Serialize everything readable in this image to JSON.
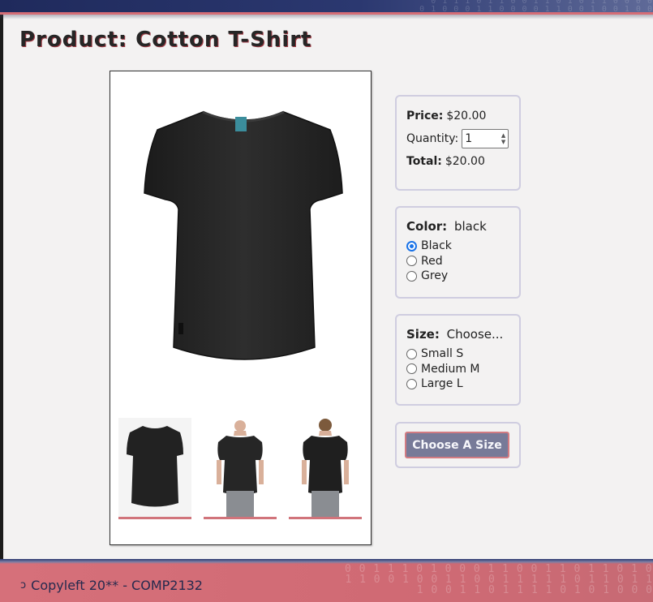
{
  "page": {
    "title": "Product: Cotton T-Shirt"
  },
  "header": {
    "binary_text": "0 1 1 1 0 1 1 0 0 1 1 0 1 0 1 1 0 0 0 0 1 1 1 1 0 0 0 0 1 1 0 1"
  },
  "gallery": {
    "main_image_icon": "black-tshirt-front-image",
    "thumbnails": [
      {
        "icon": "tshirt-front-thumbnail"
      },
      {
        "icon": "model-front-thumbnail"
      },
      {
        "icon": "model-back-thumbnail"
      }
    ]
  },
  "pricing": {
    "price_label": "Price:",
    "price_value": "$20.00",
    "quantity_label": "Quantity:",
    "quantity_value": "1",
    "total_label": "Total:",
    "total_value": "$20.00"
  },
  "color": {
    "label": "Color:",
    "selected": "black",
    "options": [
      {
        "label": "Black",
        "checked": true
      },
      {
        "label": "Red",
        "checked": false
      },
      {
        "label": "Grey",
        "checked": false
      }
    ]
  },
  "size": {
    "label": "Size:",
    "selected": "Choose...",
    "options": [
      {
        "label": "Small S",
        "checked": false
      },
      {
        "label": "Medium M",
        "checked": false
      },
      {
        "label": "Large L",
        "checked": false
      }
    ]
  },
  "action": {
    "button_label": "Choose A Size"
  },
  "footer": {
    "icon": "copyleft-icon",
    "copyleft_symbol": "ɔ",
    "text": "Copyleft 20** - COMP2132",
    "binary_text": "1 0 1 1 0 0 1 1 0 0 1 1 0 1 1 0 1 0 0 0 0 1 0 0"
  },
  "colors": {
    "header_navy": "#1f2a5c",
    "accent_pink": "#d56d76",
    "panel_border": "#cfcde0",
    "button_bg": "#777a98",
    "radio_blue": "#1a73e8"
  }
}
